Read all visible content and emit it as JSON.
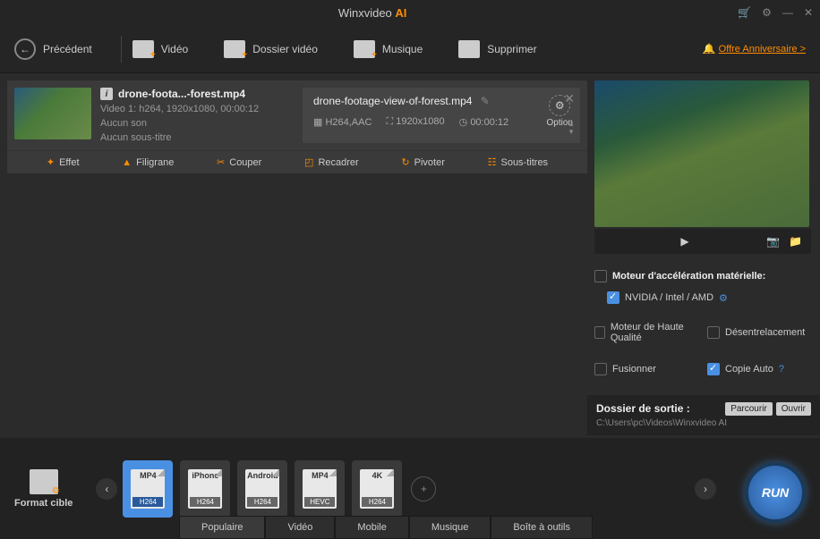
{
  "titlebar": {
    "app": "Winxvideo",
    "suffix": "AI"
  },
  "toolbar": {
    "back": "Précédent",
    "video": "Vidéo",
    "folder": "Dossier vidéo",
    "music": "Musique",
    "delete": "Supprimer",
    "anniversary": "Offre Anniversaire >"
  },
  "video": {
    "name": "drone-foota...-forest.mp4",
    "line1": "Video 1: h264, 1920x1080, 00:00:12",
    "line2": "Aucun son",
    "line3": "Aucun sous-titre",
    "output_name": "drone-footage-view-of-forest.mp4",
    "codec": "H264,AAC",
    "res": "1920x1080",
    "dur": "00:00:12",
    "option": "Option"
  },
  "tools": {
    "effect": "Effet",
    "watermark": "Filigrane",
    "cut": "Couper",
    "crop": "Recadrer",
    "rotate": "Pivoter",
    "subtitle": "Sous-titres"
  },
  "settings": {
    "hw_title": "Moteur d'accélération matérielle:",
    "hw_vendors": "NVIDIA / Intel / AMD",
    "hq": "Moteur de Haute Qualité",
    "deint": "Désentrelacement",
    "merge": "Fusionner",
    "autocopy": "Copie Auto"
  },
  "output": {
    "title": "Dossier de sortie :",
    "path": "C:\\Users\\pc\\Videos\\Winxvideo AI",
    "browse": "Parcourir",
    "open": "Ouvrir"
  },
  "formats": {
    "target": "Format cible",
    "items": [
      {
        "top": "MP4",
        "bot": "H264"
      },
      {
        "top": "iPhone",
        "bot": "H264"
      },
      {
        "top": "Android",
        "bot": "H264"
      },
      {
        "top": "MP4",
        "bot": "HEVC"
      },
      {
        "top": "4K",
        "bot": "H264"
      }
    ]
  },
  "tabs": {
    "popular": "Populaire",
    "video": "Vidéo",
    "mobile": "Mobile",
    "music": "Musique",
    "toolbox": "Boîte à outils"
  },
  "run": "RUN"
}
